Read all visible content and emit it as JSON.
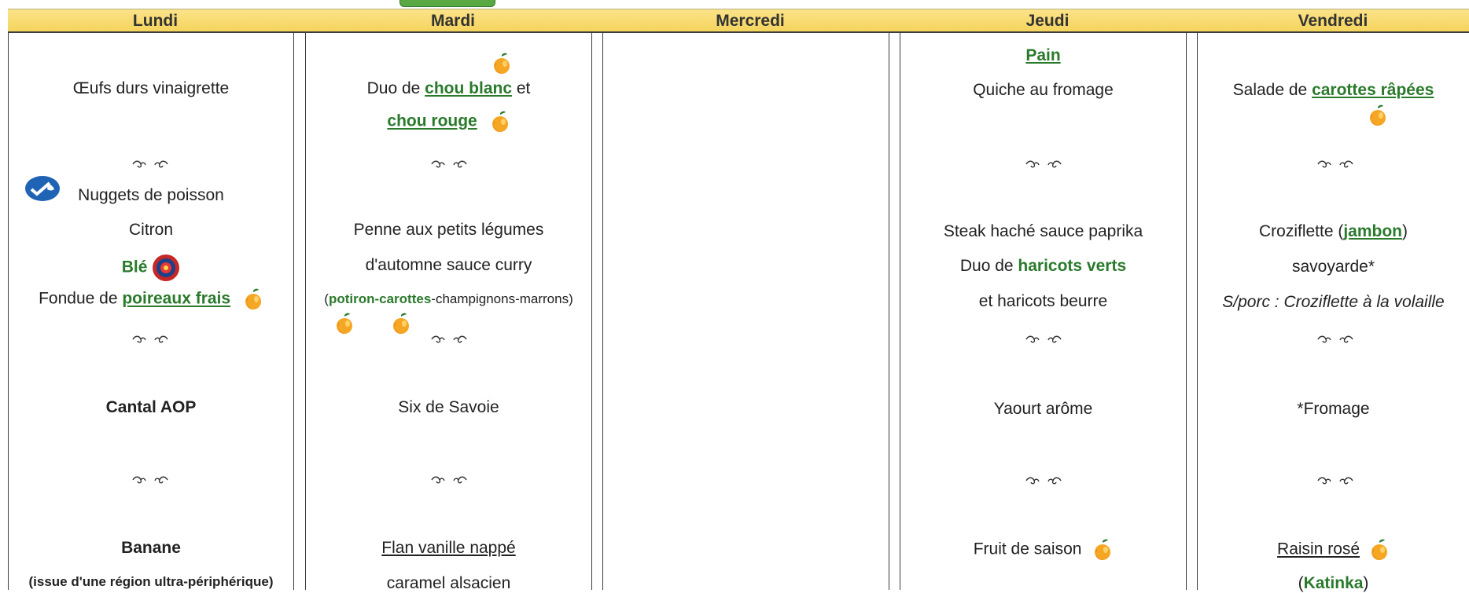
{
  "days": [
    "Lundi",
    "Mardi",
    "Mercredi",
    "Jeudi",
    "Vendredi"
  ],
  "lundi": {
    "entree": "Œufs durs vinaigrette",
    "plat": "Nuggets de poisson",
    "plat_garnish": "Citron",
    "feculent": "Blé",
    "legume_prefix": "Fondue de ",
    "legume_link": "poireaux frais",
    "fromage": "Cantal AOP",
    "dessert": "Banane",
    "dessert_note": "(issue d'une région ultra-périphérique)"
  },
  "mardi": {
    "entree_prefix": "Duo de ",
    "entree_link1": "chou blanc",
    "entree_mid": " et",
    "entree_link2": "chou rouge",
    "plat_line1": "Penne aux petits légumes",
    "plat_line2": "d'automne sauce curry",
    "plat_paren_open": "(",
    "plat_paren_green": "potiron-carottes",
    "plat_paren_rest": "-champignons-marrons)",
    "fromage": "Six de Savoie",
    "dessert_line1": "Flan vanille nappé",
    "dessert_line2": "caramel alsacien"
  },
  "jeudi": {
    "pain": "Pain",
    "entree": "Quiche au fromage",
    "plat_line1": "Steak haché sauce paprika",
    "plat_line2_prefix": "Duo de ",
    "plat_line2_green": "haricots verts",
    "plat_line3": "et haricots beurre",
    "laitage": "Yaourt arôme",
    "dessert": "Fruit de saison"
  },
  "vendredi": {
    "entree_prefix": "Salade de ",
    "entree_link": "carottes râpées ",
    "plat_prefix": "Croziflette (",
    "plat_link": "jambon",
    "plat_suffix": ")",
    "plat_line2": "savoyarde*",
    "plat_alt": "S/porc : Croziflette à la volaille",
    "fromage": "*Fromage",
    "dessert": "Raisin rosé",
    "dessert_variety_open": "(",
    "dessert_variety": "Katinka",
    "dessert_variety_close": ")"
  },
  "icons": {
    "separator": "ornament-separator-icon",
    "seasonal": "peach-seasonal-icon",
    "msc": "msc-fish-label-icon",
    "label_rouge": "label-rouge-icon"
  },
  "colors": {
    "header_bg": "#f5d45c",
    "green_text": "#2a7a2c",
    "tab_green": "#5aa844"
  }
}
